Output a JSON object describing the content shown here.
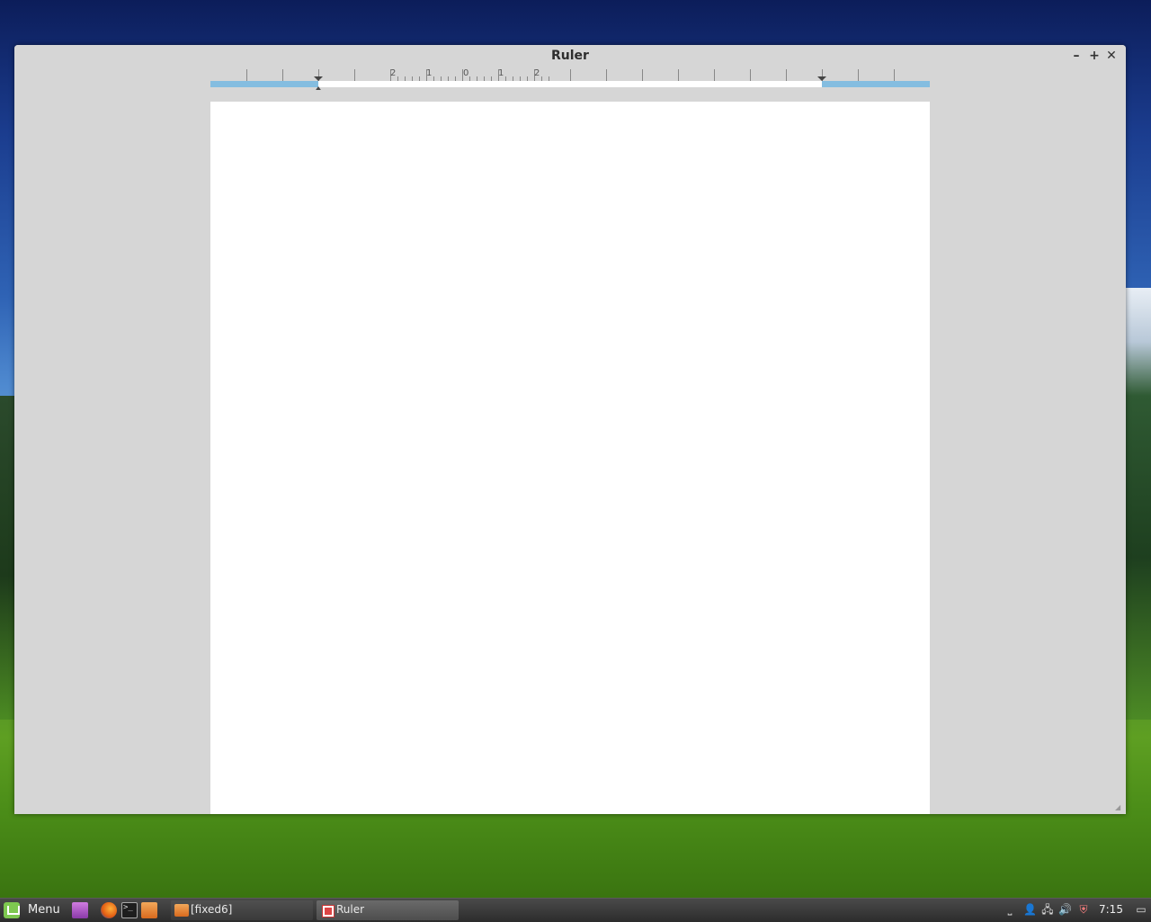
{
  "window": {
    "title": "Ruler",
    "minimize_symbol": "–",
    "maximize_symbol": "+",
    "close_symbol": "✕"
  },
  "ruler": {
    "labels": [
      "2",
      "1",
      "0",
      "1",
      "2"
    ],
    "margin_color": "#84bde0"
  },
  "taskbar": {
    "menu_label": "Menu",
    "tasks": [
      {
        "label": "[fixed6]",
        "icon": "folder-icon"
      },
      {
        "label": "Ruler",
        "icon": "app-icon"
      }
    ],
    "launchers": [
      "show-desktop-icon",
      "firefox-icon",
      "terminal-icon",
      "files-icon"
    ],
    "tray": {
      "keyboard": "⎵",
      "user": "👤",
      "network": "🖧",
      "volume": "🔊",
      "shield": "⛨",
      "display": "▭"
    },
    "clock": "7:15"
  }
}
